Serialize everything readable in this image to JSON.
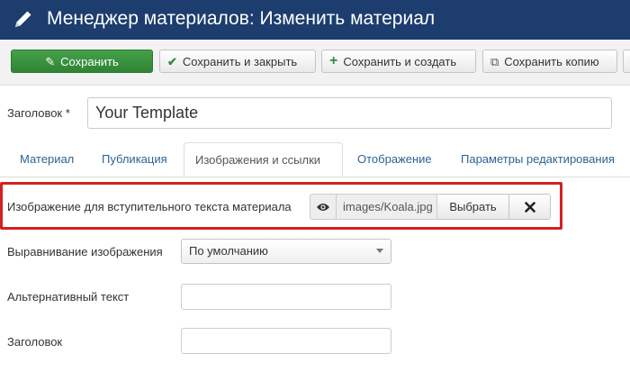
{
  "header": {
    "title": "Менеджер материалов: Изменить материал",
    "icon": "pencil-icon"
  },
  "toolbar": {
    "save": "Сохранить",
    "save_close": "Сохранить и закрыть",
    "save_new": "Сохранить и создать",
    "save_copy": "Сохранить копию"
  },
  "form": {
    "title_label": "Заголовок *",
    "title_value": "Your Template"
  },
  "tabs": [
    {
      "label": "Материал"
    },
    {
      "label": "Публикация"
    },
    {
      "label": "Изображения и ссылки",
      "active": true
    },
    {
      "label": "Отображение"
    },
    {
      "label": "Параметры редактирования"
    }
  ],
  "image_field": {
    "label": "Изображение для вступительного текста материала",
    "path": "images/Koala.jpg",
    "select_label": "Выбрать"
  },
  "align_field": {
    "label": "Выравнивание изображения",
    "value": "По умолчанию"
  },
  "alt_field": {
    "label": "Альтернативный текст",
    "value": ""
  },
  "caption_field": {
    "label": "Заголовок",
    "value": ""
  },
  "colors": {
    "header_bg": "#1c3d6e",
    "save_green": "#3a8f3e",
    "link": "#2a6496",
    "highlight": "#d42020"
  }
}
